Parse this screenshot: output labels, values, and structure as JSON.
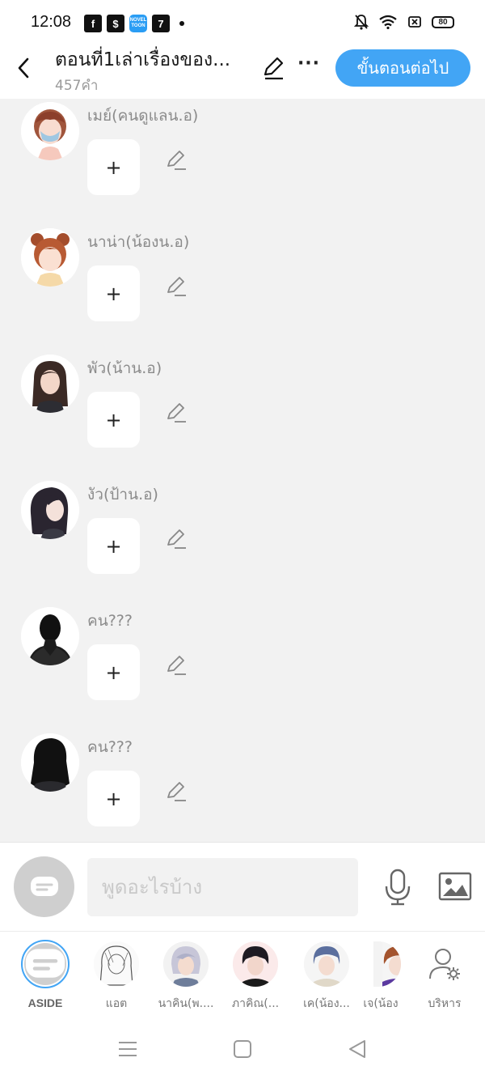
{
  "status_bar": {
    "time": "12:08",
    "notifications": [
      "facebook-icon",
      "cash-icon",
      "novel-toon-icon",
      "seven-eleven-icon"
    ],
    "novel_badge": "NOVEL TOON",
    "seven_badge": "7",
    "battery": "80"
  },
  "header": {
    "title": "ตอนที่1เล่าเรื่องของ...",
    "word_count": "457คำ",
    "next_button": "ขั้นตอนต่อไป"
  },
  "characters": [
    {
      "name": "เมย์(คนดูแลน.อ)",
      "add_label": "+",
      "avatar": "mask-girl"
    },
    {
      "name": "นาน่า(น้องน.อ)",
      "add_label": "+",
      "avatar": "bun-girl"
    },
    {
      "name": "พัว(น้าน.อ)",
      "add_label": "+",
      "avatar": "long-hair-woman"
    },
    {
      "name": "งัว(ป้าน.อ)",
      "add_label": "+",
      "avatar": "dark-hair-woman"
    },
    {
      "name": "คน???",
      "add_label": "+",
      "avatar": "silhouette-short"
    },
    {
      "name": "คน???",
      "add_label": "+",
      "avatar": "silhouette-long"
    }
  ],
  "input": {
    "placeholder": "พูดอะไรบ้าง"
  },
  "character_bar": [
    {
      "label": "ASIDE",
      "type": "aside"
    },
    {
      "label": "แอต",
      "type": "sketch"
    },
    {
      "label": "นาคิน(พ....",
      "type": "silver"
    },
    {
      "label": "ภาคิณ(...",
      "type": "dark"
    },
    {
      "label": "เค(น้อง...",
      "type": "blue"
    },
    {
      "label": "เจ(น้อง",
      "type": "brown"
    },
    {
      "label": "บริหาร",
      "type": "manage"
    }
  ],
  "colors": {
    "accent": "#42a5f5",
    "list_background": "#f2f2f2",
    "muted_text": "#8b8b8b"
  }
}
